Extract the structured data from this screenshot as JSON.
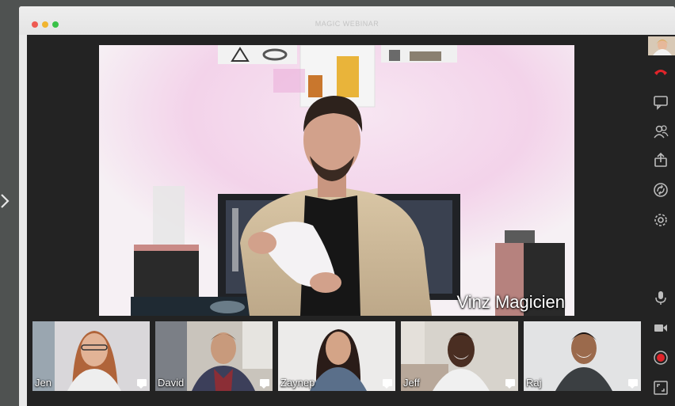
{
  "window": {
    "title": "MAGIC WEBINAR"
  },
  "main_video": {
    "speaker_name": "Vinz Magicien"
  },
  "participants": [
    {
      "name": "Jen"
    },
    {
      "name": "David"
    },
    {
      "name": "Zaynep"
    },
    {
      "name": "Jeff"
    },
    {
      "name": "Raj"
    }
  ],
  "sidebar": {
    "icons": [
      "self-view-thumbnail",
      "hang-up-icon",
      "chat-icon",
      "participants-icon",
      "share-screen-icon",
      "sync-icon",
      "settings-icon",
      "microphone-icon",
      "camera-icon",
      "record-icon",
      "fullscreen-icon"
    ]
  },
  "colors": {
    "accent": "#e0242a",
    "icon": "#bdbdbd",
    "stage": "#232323"
  }
}
